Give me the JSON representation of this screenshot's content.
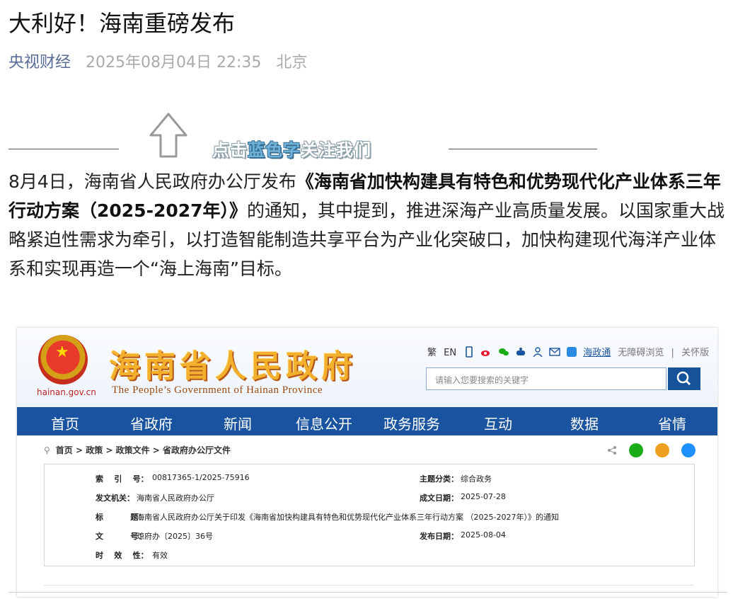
{
  "article": {
    "title": "大利好！海南重磅发布",
    "source": "央视财经",
    "datetime": "2025年08月04日 22:35",
    "location": "北京"
  },
  "follow_banner": {
    "pre": "点击",
    "blue": "蓝色字",
    "post": "关注我们"
  },
  "paragraph": {
    "p1": "8月4日，海南省人民政府办公厅发布",
    "bold": "《海南省加快构建具有特色和优势现代化产业体系三年行动方案（2025-2027年）》",
    "p2": "的通知，其中提到，推进深海产业高质量发展。以国家重大战略紧迫性需求为牵引，以打造智能制造共享平台为产业化突破口，加快构建现代海洋产业体系和实现再造一个“海上海南”目标。"
  },
  "embedded": {
    "site_name": "海南省人民政府",
    "site_name_en": "The People’s Government  of Hainan Province",
    "domain": "hainan.gov.cn",
    "tools": [
      "繁",
      "EN",
      "海政通",
      "无障碍浏览",
      "关怀版"
    ],
    "search_placeholder": "请输入您要搜索的关键字",
    "nav": [
      "首页",
      "省政府",
      "新闻",
      "信息公开",
      "政务服务",
      "互动",
      "数据",
      "省情"
    ],
    "breadcrumb": "首页 > 政策 > 政策文件 > 省政府办公厅文件",
    "info": {
      "index_label": "索    引    号：",
      "index_value": "00817365-1/2025-75916",
      "category_label": "主题分类：",
      "category_value": "综合政务",
      "issuer_label": "发文机关：",
      "issuer_value": "海南省人民政府办公厅",
      "created_label": "成文日期：",
      "created_value": "2025-07-28",
      "title_label": "标          题：",
      "title_value": "海南省人民政府办公厅关于印发《海南省加快构建具有特色和优势现代化产业体系三年行动方案 （2025-2027年）》的通知",
      "docno_label": "文          号：",
      "docno_value": "琼府办〔2025〕36号",
      "published_label": "发布日期：",
      "published_value": "2025-08-04",
      "validity_label": "时    效    性：",
      "validity_value": "有效"
    }
  },
  "colors": {
    "nav_blue": "#1a54a0",
    "source_blue": "#576b95",
    "wechat_green": "#1aad19",
    "weibo_orange": "#f0a020",
    "qzone_blue": "#1e90ff"
  }
}
